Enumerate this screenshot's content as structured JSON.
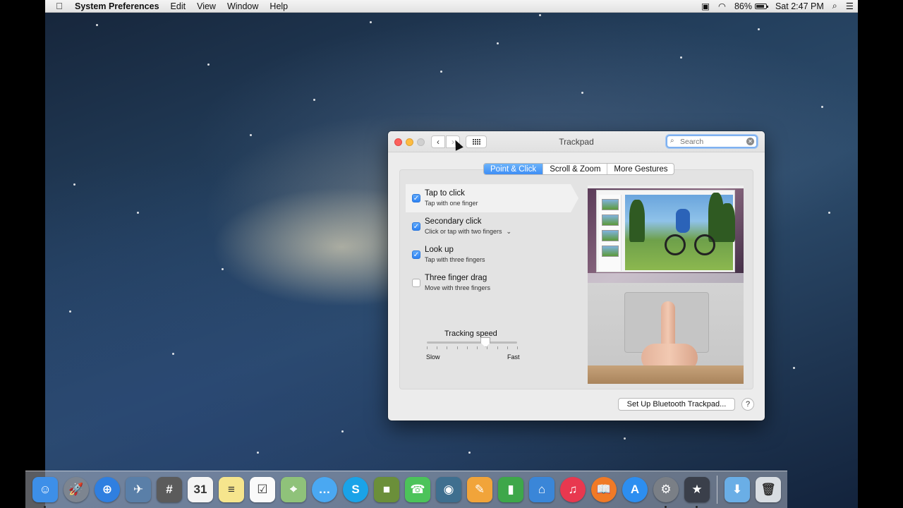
{
  "menubar": {
    "app_name": "System Preferences",
    "menus": [
      "Edit",
      "View",
      "Window",
      "Help"
    ],
    "battery": "86%",
    "battery_level": 0.86,
    "clock": "Sat 2:47 PM"
  },
  "window": {
    "title": "Trackpad",
    "search_placeholder": "Search",
    "tabs": [
      {
        "label": "Point & Click",
        "active": true
      },
      {
        "label": "Scroll & Zoom",
        "active": false
      },
      {
        "label": "More Gestures",
        "active": false
      }
    ],
    "options": [
      {
        "title": "Tap to click",
        "subtitle": "Tap with one finger",
        "checked": true,
        "selected": true
      },
      {
        "title": "Secondary click",
        "subtitle": "Click or tap with two fingers",
        "checked": true,
        "selected": false,
        "has_menu": true
      },
      {
        "title": "Look up",
        "subtitle": "Tap with three fingers",
        "checked": true,
        "selected": false
      },
      {
        "title": "Three finger drag",
        "subtitle": "Move with three fingers",
        "checked": false,
        "selected": false
      }
    ],
    "tracking": {
      "label": "Tracking speed",
      "min_label": "Slow",
      "max_label": "Fast",
      "value": 0.65,
      "ticks": 10
    },
    "bluetooth_button": "Set Up Bluetooth Trackpad...",
    "help_button": "?"
  },
  "dock": {
    "apps": [
      {
        "name": "finder-icon",
        "color": "#3d8fe8",
        "glyph": "☺",
        "running": true
      },
      {
        "name": "launchpad-icon",
        "color": "#7d8590",
        "glyph": "🚀",
        "round": true
      },
      {
        "name": "safari-icon",
        "color": "#2f7fe0",
        "glyph": "⊕",
        "round": true
      },
      {
        "name": "preview-icon",
        "color": "#5a7fa8",
        "glyph": "✈"
      },
      {
        "name": "calculator-icon",
        "color": "#5b5b5b",
        "glyph": "#"
      },
      {
        "name": "calendar-icon",
        "color": "#f4f4f4",
        "glyph": "31",
        "dark": true
      },
      {
        "name": "notes-icon",
        "color": "#f6e58d",
        "glyph": "≡",
        "dark": true
      },
      {
        "name": "reminders-icon",
        "color": "#fafafa",
        "glyph": "☑",
        "dark": true
      },
      {
        "name": "maps-icon",
        "color": "#8fc27a",
        "glyph": "⌖"
      },
      {
        "name": "messages-icon",
        "color": "#4aa8f2",
        "glyph": "…",
        "round": true
      },
      {
        "name": "skype-icon",
        "color": "#1aa3e8",
        "glyph": "S",
        "round": true
      },
      {
        "name": "minecraft-icon",
        "color": "#6b8f3a",
        "glyph": "■"
      },
      {
        "name": "facetime-icon",
        "color": "#4cc35a",
        "glyph": "☎"
      },
      {
        "name": "photo-booth-icon",
        "color": "#3f6f8f",
        "glyph": "◉"
      },
      {
        "name": "pages-icon",
        "color": "#f1a43a",
        "glyph": "✎"
      },
      {
        "name": "numbers-icon",
        "color": "#3ea74a",
        "glyph": "▮"
      },
      {
        "name": "keynote-icon",
        "color": "#3a86d8",
        "glyph": "⌂"
      },
      {
        "name": "itunes-icon",
        "color": "#e8384f",
        "glyph": "♫",
        "round": true
      },
      {
        "name": "ibooks-icon",
        "color": "#f07a26",
        "glyph": "📖",
        "round": true
      },
      {
        "name": "app-store-icon",
        "color": "#2d8ef0",
        "glyph": "A",
        "round": true
      },
      {
        "name": "system-preferences-icon",
        "color": "#7a7f86",
        "glyph": "⚙",
        "round": true,
        "running": true
      },
      {
        "name": "imovie-icon",
        "color": "#3a3f4a",
        "glyph": "★",
        "running": true
      }
    ],
    "right": [
      {
        "name": "downloads-folder-icon",
        "color": "#6aaee6",
        "glyph": "⬇"
      },
      {
        "name": "trash-icon",
        "color": "#d8dde2",
        "glyph": "🗑",
        "dark": true
      }
    ]
  }
}
